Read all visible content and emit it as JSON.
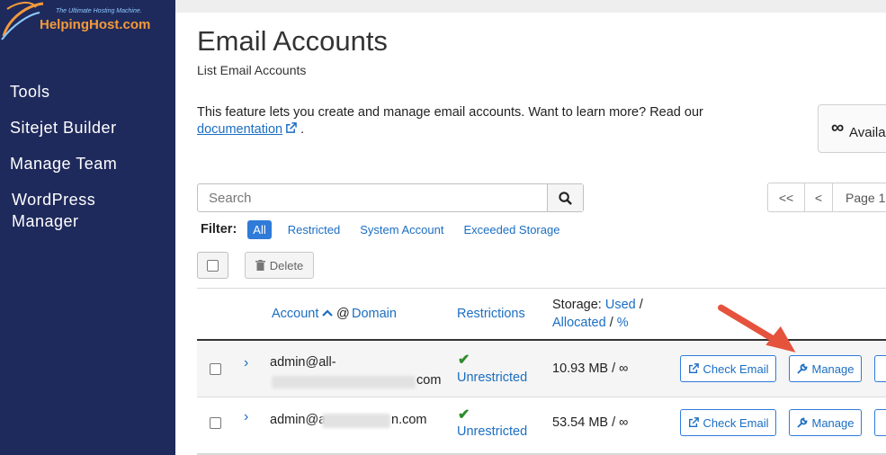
{
  "brand": {
    "tagline": "The Ultimate Hosting Machine.",
    "name": "HelpingHost.com"
  },
  "sidebar": {
    "items": [
      {
        "label": "Tools"
      },
      {
        "label": "Sitejet Builder"
      },
      {
        "label": "Manage Team"
      },
      {
        "label": "WordPress"
      },
      {
        "label": "Manager"
      }
    ]
  },
  "page": {
    "title": "Email Accounts",
    "subtitle": "List Email Accounts",
    "description": "This feature lets you create and manage email accounts. Want to learn more? Read our",
    "doc_link": "documentation",
    "doc_suffix": ".",
    "available_symbol": "∞",
    "available_label": "Availal"
  },
  "search": {
    "placeholder": "Search"
  },
  "pagination": {
    "first": "<<",
    "prev": "<",
    "page": "Page 1"
  },
  "filter": {
    "label": "Filter:",
    "options": [
      "All",
      "Restricted",
      "System Account",
      "Exceeded Storage"
    ],
    "selected": "All"
  },
  "toolbar": {
    "delete_label": "Delete"
  },
  "table": {
    "headers": {
      "account": "Account",
      "at": "@",
      "domain": "Domain",
      "restrictions": "Restrictions",
      "storage_prefix": "Storage:",
      "used": "Used",
      "slash1": "/",
      "allocated": "Allocated",
      "slash2": "/",
      "percent": "%"
    },
    "rows": [
      {
        "account_line1": "admin@all-",
        "account_line2": "com",
        "restriction": "Unrestricted",
        "storage": "10.93 MB / ∞",
        "check_email": "Check Email",
        "manage": "Manage"
      },
      {
        "account_line1_a": "admin@a",
        "account_line1_b": "n.com",
        "restriction": "Unrestricted",
        "storage": "53.54 MB / ∞",
        "check_email": "Check Email",
        "manage": "Manage"
      }
    ]
  },
  "colors": {
    "sidebar_bg": "#1f2a5c",
    "link": "#1b6ec2",
    "accent": "#2f7bd8",
    "success": "#2e8b2e",
    "annotation_arrow": "#e5533d"
  }
}
